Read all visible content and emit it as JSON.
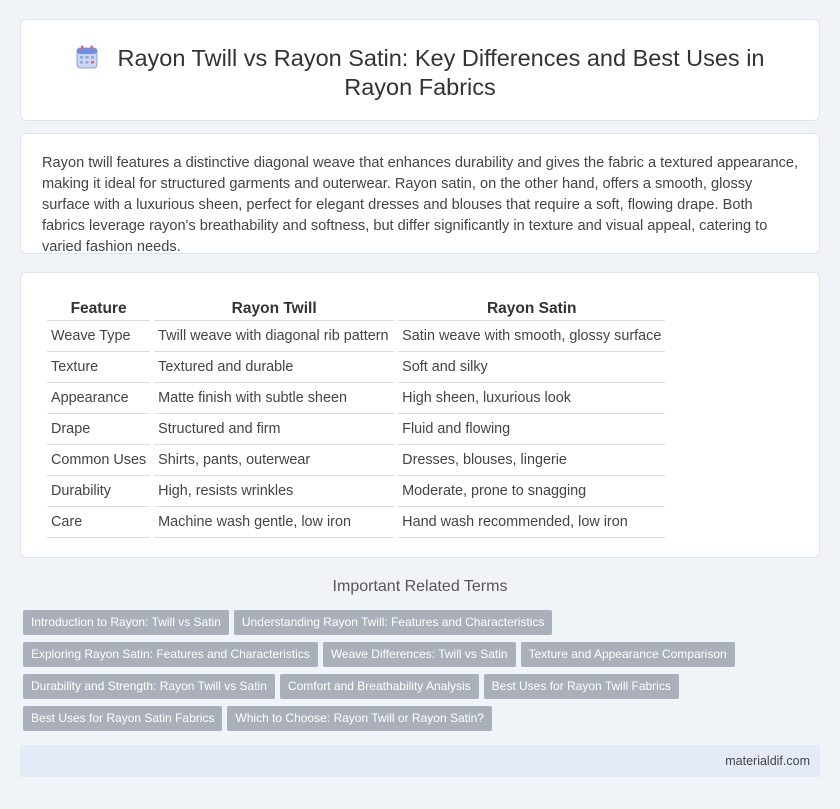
{
  "header": {
    "title": "Rayon Twill vs Rayon Satin: Key Differences and Best Uses in Rayon Fabrics",
    "icon": "calendar-icon"
  },
  "intro": {
    "text": "Rayon twill features a distinctive diagonal weave that enhances durability and gives the fabric a textured appearance, making it ideal for structured garments and outerwear. Rayon satin, on the other hand, offers a smooth, glossy surface with a luxurious sheen, perfect for elegant dresses and blouses that require a soft, flowing drape. Both fabrics leverage rayon's breathability and softness, but differ significantly in texture and visual appeal, catering to varied fashion needs."
  },
  "table": {
    "headers": [
      "Feature",
      "Rayon Twill",
      "Rayon Satin"
    ],
    "rows": [
      [
        "Weave Type",
        "Twill weave with diagonal rib pattern",
        "Satin weave with smooth, glossy surface"
      ],
      [
        "Texture",
        "Textured and durable",
        "Soft and silky"
      ],
      [
        "Appearance",
        "Matte finish with subtle sheen",
        "High sheen, luxurious look"
      ],
      [
        "Drape",
        "Structured and firm",
        "Fluid and flowing"
      ],
      [
        "Common Uses",
        "Shirts, pants, outerwear",
        "Dresses, blouses, lingerie"
      ],
      [
        "Durability",
        "High, resists wrinkles",
        "Moderate, prone to snagging"
      ],
      [
        "Care",
        "Machine wash gentle, low iron",
        "Hand wash recommended, low iron"
      ]
    ]
  },
  "related": {
    "title": "Important Related Terms",
    "tag_rows": [
      [
        "Introduction to Rayon: Twill vs Satin",
        "Understanding Rayon Twill: Features and Characteristics"
      ],
      [
        "Exploring Rayon Satin: Features and Characteristics",
        "Weave Differences: Twill vs Satin",
        "Texture and Appearance Comparison"
      ],
      [
        "Durability and Strength: Rayon Twill vs Satin",
        "Comfort and Breathability Analysis",
        "Best Uses for Rayon Twill Fabrics"
      ],
      [
        "Best Uses for Rayon Satin Fabrics",
        "Which to Choose: Rayon Twill or Rayon Satin?"
      ]
    ]
  },
  "footer": {
    "site": "materialdif.com"
  },
  "colors": {
    "background": "#f0f3f8",
    "tag": "#a9b0ba",
    "footer": "#e4eaf6"
  }
}
